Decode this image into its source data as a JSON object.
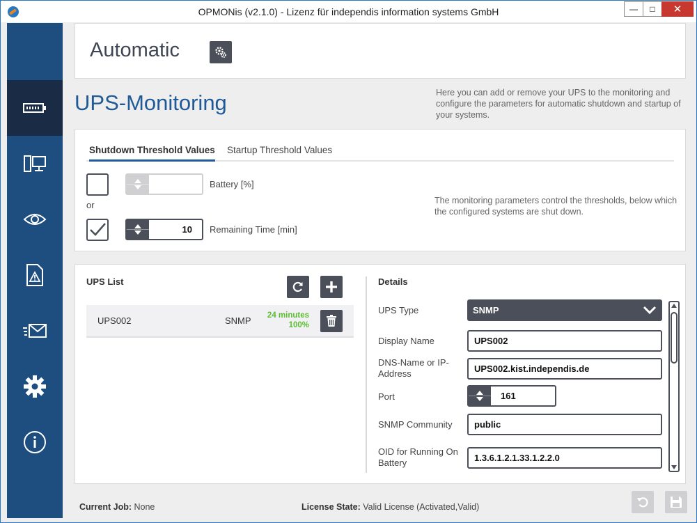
{
  "window": {
    "title": "OPMONis (v2.1.0) - Lizenz für independis information systems GmbH",
    "min_glyph": "—",
    "max_glyph": "□",
    "close_glyph": "✕"
  },
  "sidebar": {
    "items": [
      {
        "icon": "battery-icon",
        "active": true
      },
      {
        "icon": "devices-icon",
        "active": false
      },
      {
        "icon": "eye-icon",
        "active": false
      },
      {
        "icon": "warning-document-icon",
        "active": false
      },
      {
        "icon": "mail-icon",
        "active": false
      },
      {
        "icon": "gear-icon",
        "active": false
      },
      {
        "icon": "info-icon",
        "active": false
      }
    ]
  },
  "header": {
    "mode_title": "Automatic",
    "mode_button_icon": "gears-icon"
  },
  "section": {
    "title": "UPS-Monitoring",
    "description": "Here you can add or remove your UPS to the monitoring and configure the parameters for automatic shutdown and startup of your systems."
  },
  "thresholds": {
    "tabs": [
      "Shutdown Threshold Values",
      "Startup Threshold Values"
    ],
    "battery": {
      "checked": false,
      "value": "",
      "label": "Battery [%]"
    },
    "or_label": "or",
    "remaining": {
      "checked": true,
      "value": "10",
      "label": "Remaining Time [min]"
    },
    "note": "The monitoring parameters control the thresholds, below which the configured systems are shut down."
  },
  "ups_list": {
    "title": "UPS List",
    "refresh_icon": "refresh-icon",
    "add_icon": "plus-icon",
    "rows": [
      {
        "name": "UPS002",
        "protocol": "SNMP",
        "runtime": "24 minutes",
        "charge": "100%",
        "delete_icon": "trash-icon"
      }
    ]
  },
  "details": {
    "title": "Details",
    "ups_type_label": "UPS Type",
    "ups_type_value": "SNMP",
    "display_name_label": "Display Name",
    "display_name_value": "UPS002",
    "dns_label": "DNS-Name or IP-Address",
    "dns_value": "UPS002.kist.independis.de",
    "port_label": "Port",
    "port_value": "161",
    "community_label": "SNMP Community",
    "community_value": "public",
    "oid_label": "OID for Running On Battery",
    "oid_value": "1.3.6.1.2.1.33.1.2.2.0"
  },
  "status": {
    "job_label": "Current Job:",
    "job_value": "None",
    "license_label": "License State:",
    "license_value": "Valid License (Activated,Valid)"
  },
  "footer": {
    "undo_icon": "undo-icon",
    "save_icon": "save-icon"
  },
  "colors": {
    "sidebar": "#1e4d80",
    "sidebar_active": "#1a2b45",
    "accent": "#1f5a96",
    "control_dark": "#4a4f59",
    "status_green": "#5bbd31"
  }
}
